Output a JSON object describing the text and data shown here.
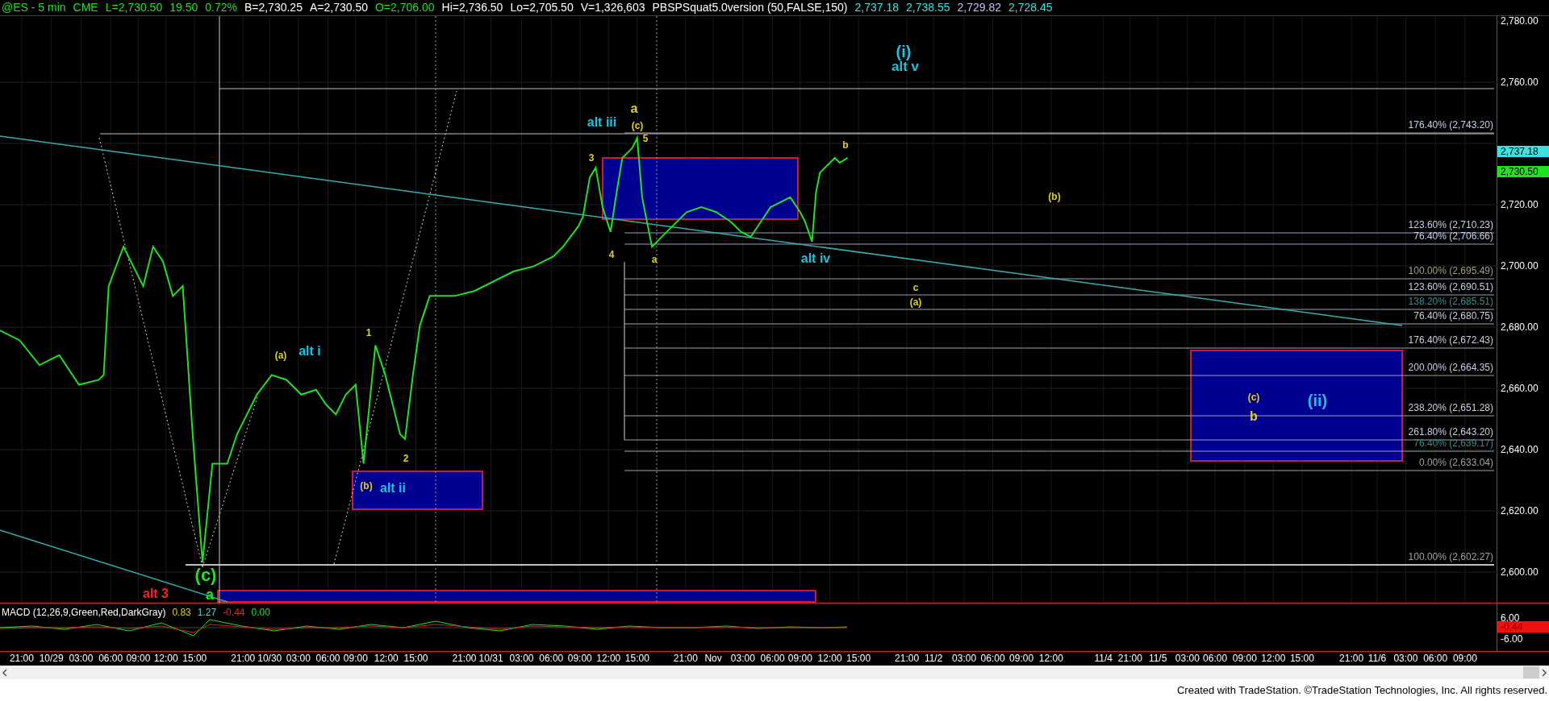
{
  "header": [
    {
      "text": "@ES - 5 min",
      "color": "#22e022"
    },
    {
      "text": "CME",
      "color": "#22e022"
    },
    {
      "text": "L=2,730.50",
      "color": "#22e022"
    },
    {
      "text": "19.50",
      "color": "#22e022"
    },
    {
      "text": "0.72%",
      "color": "#22e022"
    },
    {
      "text": "B=2,730.25",
      "color": "#ffffff"
    },
    {
      "text": "A=2,730.50",
      "color": "#ffffff"
    },
    {
      "text": "O=2,706.00",
      "color": "#22e022"
    },
    {
      "text": "Hi=2,736.50",
      "color": "#ffffff"
    },
    {
      "text": "Lo=2,705.50",
      "color": "#ffffff"
    },
    {
      "text": "V=1,326,603",
      "color": "#ffffff"
    },
    {
      "text": "PBSPSquat5.0version (50,FALSE,150)",
      "color": "#ffffff"
    },
    {
      "text": "2,737.18",
      "color": "#40e0e0"
    },
    {
      "text": "2,738.55",
      "color": "#40e0e0"
    },
    {
      "text": "2,729.82",
      "color": "#c0c0ff"
    },
    {
      "text": "2,728.45",
      "color": "#40e0e0"
    }
  ],
  "wave_labels": [
    {
      "text": "(i)",
      "color": "#20c0e0"
    },
    {
      "text": "alt v",
      "color": "#20c0e0"
    },
    {
      "text": "a",
      "color": "#e0d020"
    },
    {
      "text": "alt iii",
      "color": "#20c0e0"
    },
    {
      "text": "(c)",
      "color": "#e0d020"
    },
    {
      "text": "3",
      "color": "#e0d020"
    },
    {
      "text": "5",
      "color": "#e0d020"
    },
    {
      "text": "b",
      "color": "#e0d020"
    },
    {
      "text": "(b)",
      "color": "#e0d020"
    },
    {
      "text": "4",
      "color": "#e0d020"
    },
    {
      "text": "a",
      "color": "#e0d020"
    },
    {
      "text": "alt iv",
      "color": "#20c0e0"
    },
    {
      "text": "c",
      "color": "#e0d020"
    },
    {
      "text": "(a)",
      "color": "#e0d020"
    },
    {
      "text": "(a)",
      "color": "#e0d020"
    },
    {
      "text": "alt i",
      "color": "#20c0e0"
    },
    {
      "text": "1",
      "color": "#e0d020"
    },
    {
      "text": "2",
      "color": "#e0d020"
    },
    {
      "text": "(b)",
      "color": "#e0d020"
    },
    {
      "text": "alt ii",
      "color": "#20c0e0"
    },
    {
      "text": "(c)",
      "color": "#22e022"
    },
    {
      "text": "a",
      "color": "#22e022"
    },
    {
      "text": "alt 3",
      "color": "#ff2020"
    },
    {
      "text": "(c)",
      "color": "#e0d020"
    },
    {
      "text": "(ii)",
      "color": "#20c0e0"
    },
    {
      "text": "b",
      "color": "#e0d020"
    }
  ],
  "fib_levels": [
    {
      "text": "176.40% (2,743.20)",
      "color": "#c8d0e8"
    },
    {
      "text": "123.60% (2,710.23)",
      "color": "#c8d0e8"
    },
    {
      "text": "76.40% (2,706.66)",
      "color": "#c8d0e8"
    },
    {
      "text": "100.00% (2,695.49)",
      "color": "#a0a080"
    },
    {
      "text": "123.60% (2,690.51)",
      "color": "#c8d0e8"
    },
    {
      "text": "138.20% (2,685.51)",
      "color": "#309090"
    },
    {
      "text": "76.40% (2,680.75)",
      "color": "#c8d0e8"
    },
    {
      "text": "176.40% (2,672.43)",
      "color": "#c8d0e8"
    },
    {
      "text": "200.00% (2,664.35)",
      "color": "#c8d0e8"
    },
    {
      "text": "238.20% (2,651.28)",
      "color": "#c8d0e8"
    },
    {
      "text": "261.80% (2,643.20)",
      "color": "#c8d0e8"
    },
    {
      "text": "76.40% (2,639.17)",
      "color": "#309090"
    },
    {
      "text": "0.00% (2,633.04)",
      "color": "#a0a0a0"
    },
    {
      "text": "100.00% (2,602.27)",
      "color": "#a0a0a0"
    }
  ],
  "price_axis": [
    "2,780.00",
    "2,760.00",
    "2,720.00",
    "2,700.00",
    "2,680.00",
    "2,660.00",
    "2,640.00",
    "2,620.00",
    "2,600.00"
  ],
  "price_markers": [
    {
      "text": "2,737.18",
      "color": "#40e0e0"
    },
    {
      "text": "2,730.50",
      "color": "#22e022"
    }
  ],
  "macd": {
    "legend": [
      {
        "text": "MACD (12,26,9,Green,Red,DarkGray)",
        "color": "#ffffff"
      },
      {
        "text": "0.83",
        "color": "#e0d020"
      },
      {
        "text": "1.27",
        "color": "#40e0e0"
      },
      {
        "text": "-0.44",
        "color": "#ff2020"
      },
      {
        "text": "0.00",
        "color": "#22e022"
      }
    ],
    "axis": [
      "6.00",
      "-6.00"
    ],
    "marker": "-0.44"
  },
  "time_axis": [
    "21:00",
    "10/29",
    "03:00",
    "06:00",
    "09:00",
    "12:00",
    "15:00",
    "21:00",
    "10/30",
    "03:00",
    "06:00",
    "09:00",
    "12:00",
    "15:00",
    "21:00",
    "10/31",
    "03:00",
    "06:00",
    "09:00",
    "12:00",
    "15:00",
    "21:00",
    "Nov",
    "03:00",
    "06:00",
    "09:00",
    "12:00",
    "15:00",
    "21:00",
    "11/2",
    "03:00",
    "06:00",
    "09:00",
    "12:00",
    "11/4",
    "21:00",
    "11/5",
    "03:00",
    "06:00",
    "09:00",
    "12:00",
    "15:00",
    "21:00",
    "11/6",
    "03:00",
    "06:00",
    "09:00"
  ],
  "footer": "Created with TradeStation. ©TradeStation Technologies, Inc. All rights reserved."
}
